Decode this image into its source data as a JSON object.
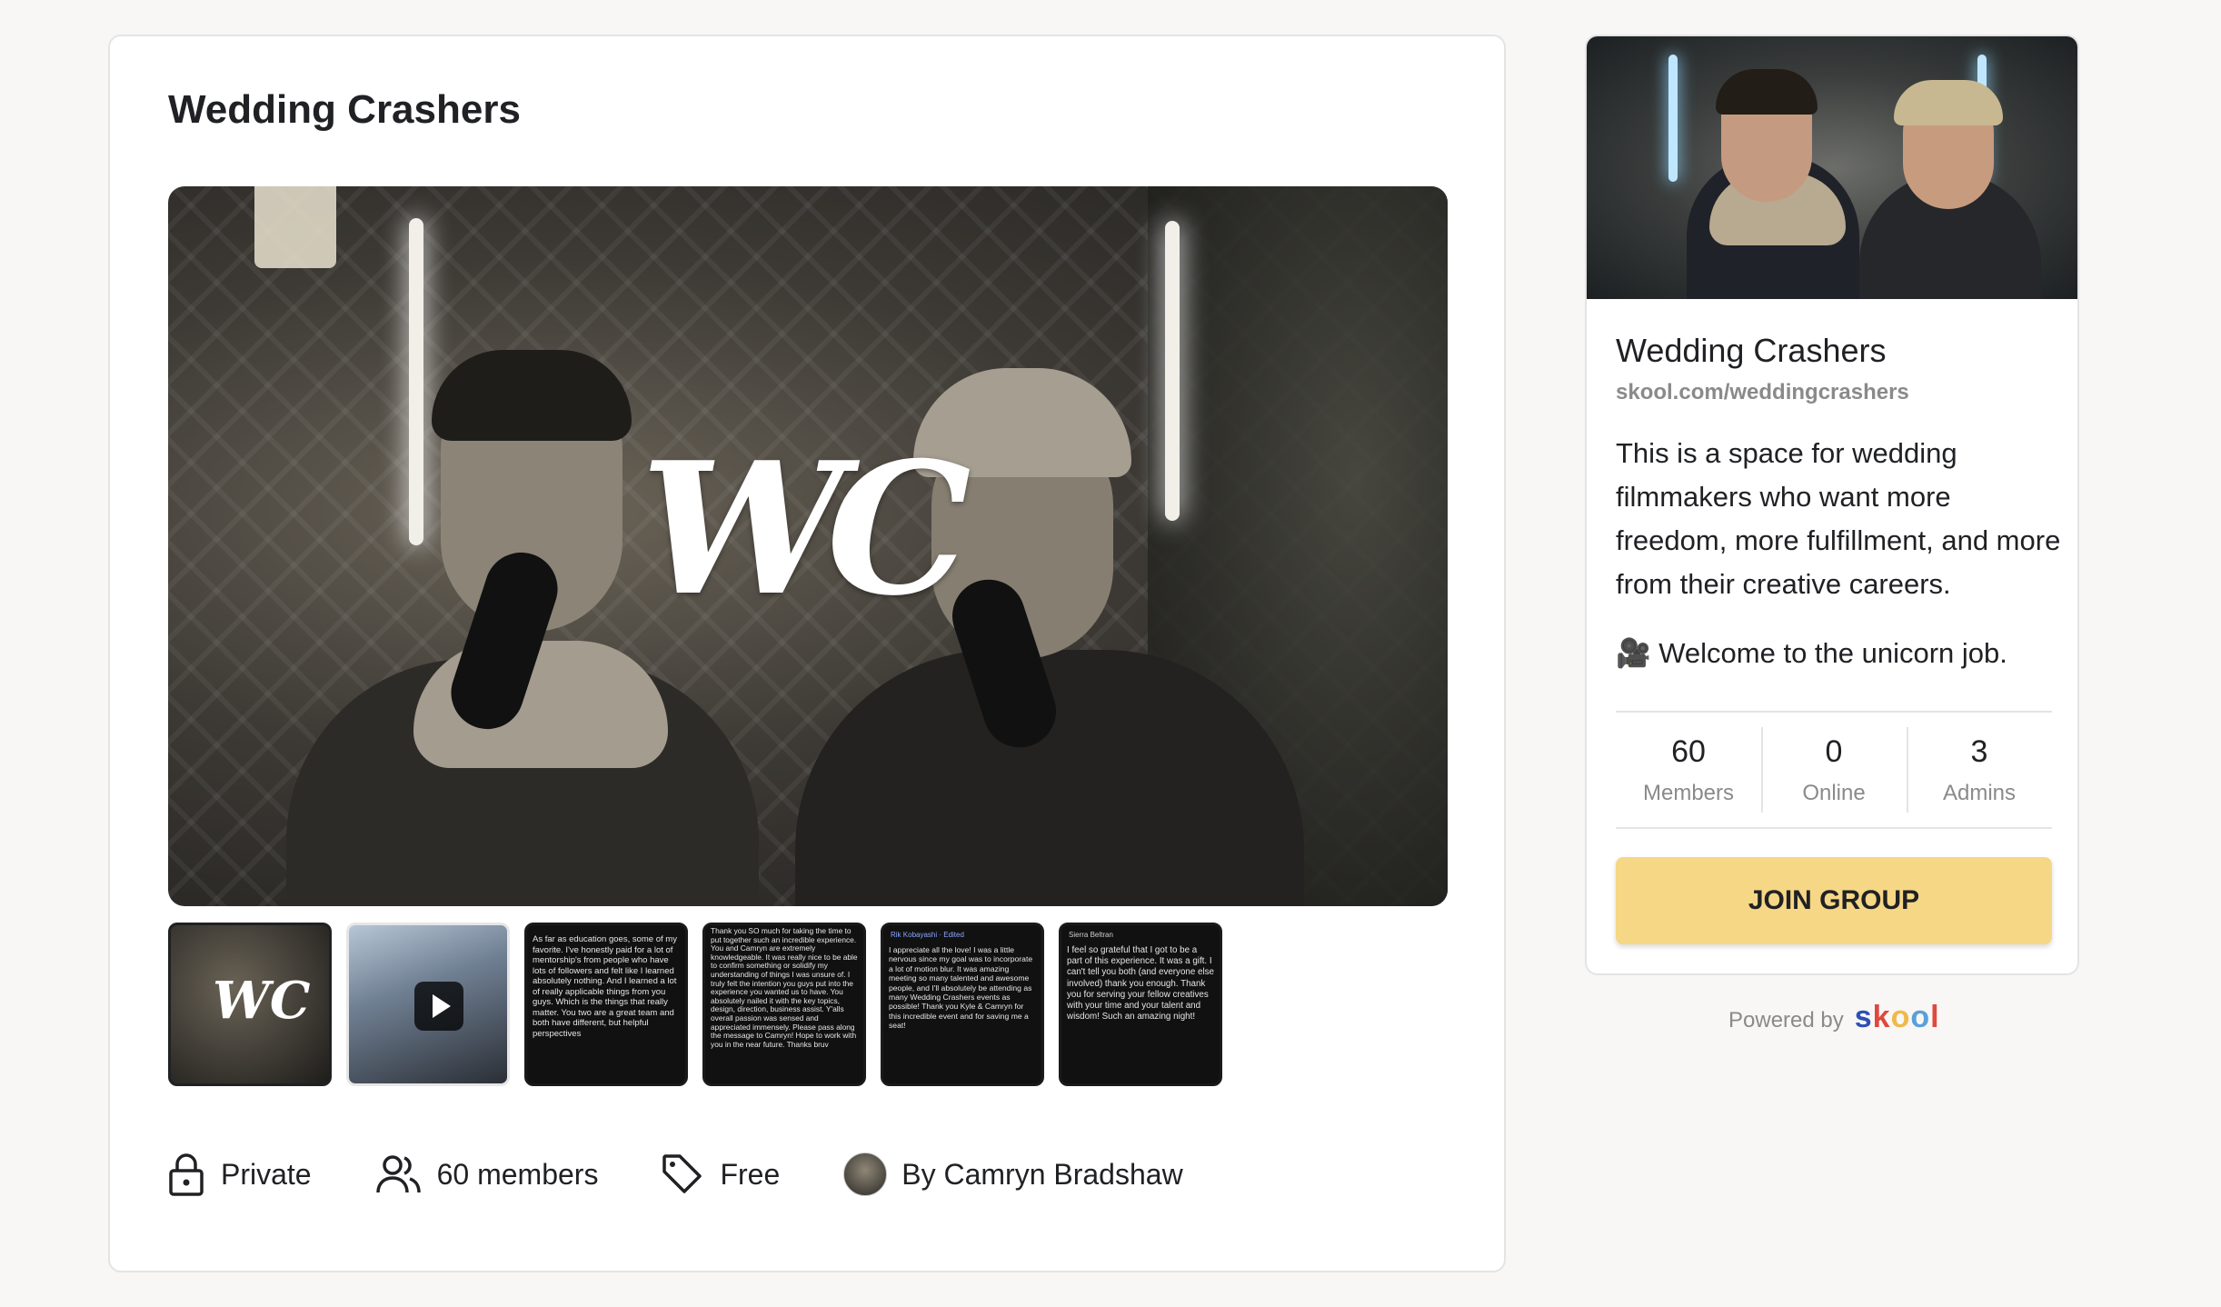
{
  "main": {
    "title": "Wedding Crashers",
    "hero_logo": "WC",
    "thumbnails": [
      {
        "kind": "image",
        "label": "WC"
      },
      {
        "kind": "video"
      },
      {
        "kind": "text",
        "text": "As far as education goes, some of my favorite. I've honestly paid for a lot of mentorship's from people who have lots of followers and felt like I learned absolutely nothing. And I learned a lot of really applicable things from you guys. Which is the things that really matter. You two are a great team and both have different, but helpful perspectives"
      },
      {
        "kind": "text",
        "text": "Thank you SO much for taking the time to put together such an incredible experience. You and Camryn are extremely knowledgeable. It was really nice to be able to confirm something or solidify my understanding of things I was unsure of. I truly felt the intention you guys put into the experience you wanted us to have. You absolutely nailed it with the key topics, design, direction, business assist. Y'alls overall passion was sensed and appreciated immensely. Please pass along the message to Camryn! Hope to work with you in the near future. Thanks bruv"
      },
      {
        "kind": "text",
        "header": "Rik Kobayashi · Edited",
        "text": "I appreciate all the love! I was a little nervous since my goal was to incorporate a lot of motion blur. It was amazing meeting so many talented and awesome people, and I'll absolutely be attending as many Wedding Crashers events as possible! Thank you Kyle & Camryn for this incredible event and for saving me a seat!"
      },
      {
        "kind": "text",
        "header": "Sierra Beltran",
        "text": "I feel so grateful that I got to be a part of this experience. It was a gift. I can't tell you both (and everyone else involved) thank you enough. Thank you for serving your fellow creatives with your time and your talent and wisdom! Such an amazing night!"
      }
    ],
    "meta": {
      "privacy": "Private",
      "members": "60 members",
      "price": "Free",
      "author": "By Camryn Bradshaw"
    }
  },
  "sidebar": {
    "name": "Wedding Crashers",
    "url": "skool.com/weddingcrashers",
    "description": "This is a space for wedding filmmakers who want more freedom, more fulfillment, and more from their creative careers.",
    "welcome": "🎥 Welcome to the unicorn job.",
    "stats": [
      {
        "value": "60",
        "label": "Members"
      },
      {
        "value": "0",
        "label": "Online"
      },
      {
        "value": "3",
        "label": "Admins"
      }
    ],
    "join_label": "JOIN GROUP"
  },
  "footer": {
    "powered_by": "Powered by",
    "brand_letters": [
      "s",
      "k",
      "o",
      "o",
      "l"
    ]
  },
  "colors": {
    "join_button": "#f5d785",
    "muted_text": "#8a8a8a",
    "page_bg": "#f8f7f5"
  }
}
